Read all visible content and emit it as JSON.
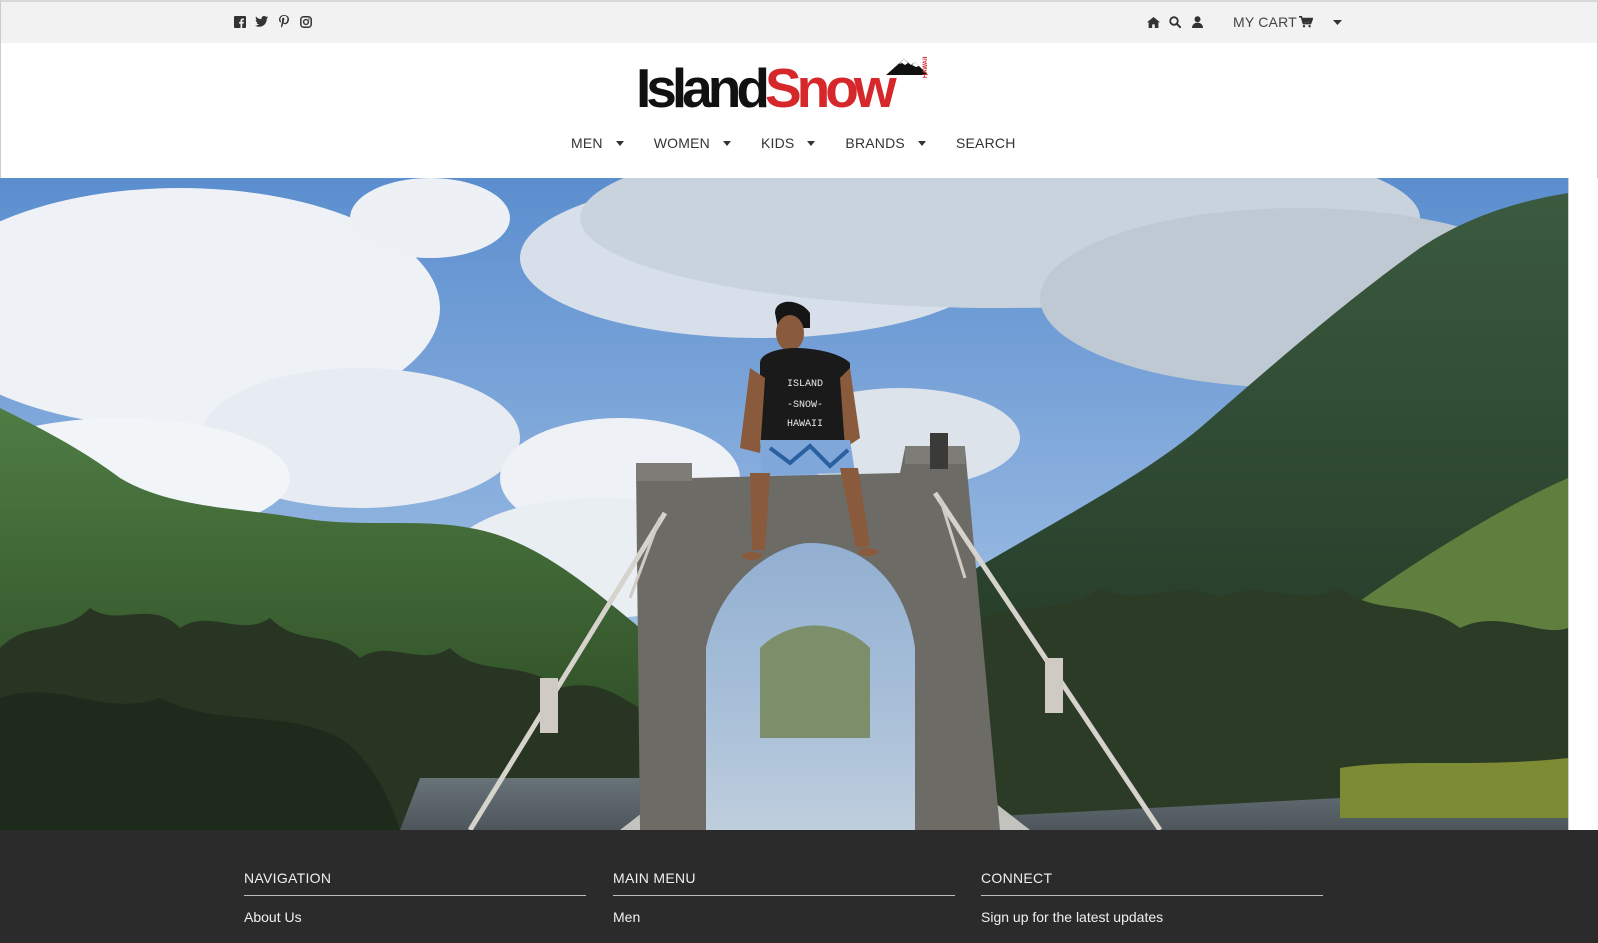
{
  "topbar": {
    "social": [
      {
        "name": "facebook-icon"
      },
      {
        "name": "twitter-icon"
      },
      {
        "name": "pinterest-icon"
      },
      {
        "name": "instagram-icon"
      }
    ],
    "cart_label": "MY CART"
  },
  "logo": {
    "word1": "Island",
    "word2": "Snow",
    "tag": "HAWAII",
    "brand_color": "#d6282b"
  },
  "nav": {
    "items": [
      {
        "label": "MEN",
        "has_dropdown": true
      },
      {
        "label": "WOMEN",
        "has_dropdown": true
      },
      {
        "label": "KIDS",
        "has_dropdown": true
      },
      {
        "label": "BRANDS",
        "has_dropdown": true
      },
      {
        "label": "SEARCH",
        "has_dropdown": false
      }
    ]
  },
  "hero": {
    "shirt_text": [
      "ISLAND",
      "-SNOW-",
      "HAWAII"
    ]
  },
  "footer": {
    "columns": [
      {
        "heading": "NAVIGATION",
        "first_link": "About Us"
      },
      {
        "heading": "MAIN MENU",
        "first_link": "Men"
      },
      {
        "heading": "CONNECT",
        "first_link": "Sign up for the latest updates"
      }
    ]
  }
}
